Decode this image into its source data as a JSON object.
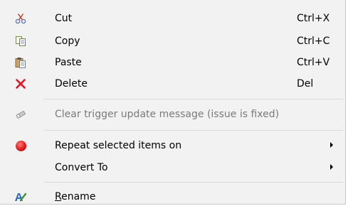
{
  "menu": {
    "items": [
      {
        "label": "Cut",
        "shortcut": "Ctrl+X",
        "icon": "scissors-icon"
      },
      {
        "label": "Copy",
        "shortcut": "Ctrl+C",
        "icon": "copy-icon"
      },
      {
        "label": "Paste",
        "shortcut": "Ctrl+V",
        "icon": "paste-icon"
      },
      {
        "label": "Delete",
        "shortcut": "Del",
        "icon": "delete-icon"
      },
      {
        "label": "Clear trigger update message (issue is fixed)",
        "icon": "eraser-icon",
        "disabled": true
      },
      {
        "label": "Repeat selected items on",
        "icon": "red-dot-icon",
        "submenu": true
      },
      {
        "label": "Convert To",
        "submenu": true
      },
      {
        "label_first": "R",
        "label_rest": "ename",
        "icon": "rename-icon"
      }
    ]
  },
  "colors": {
    "menu_bg": "#f2f2f2",
    "disabled_text": "#7a7a7a",
    "separator": "#d9d9d9",
    "delete_red": "#e81123"
  }
}
